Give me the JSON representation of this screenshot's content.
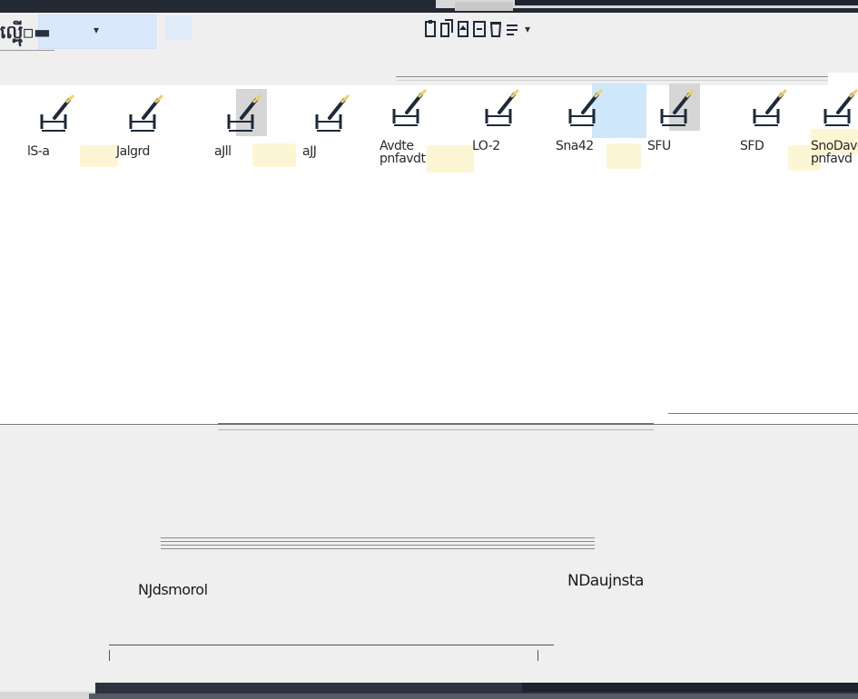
{
  "toolbar": {
    "view_label": "ល្អ៉ើ្ម▫▬",
    "view_caret": "▾",
    "center_caret": "▾"
  },
  "colors": {
    "titlebar": "#242a33",
    "taskbar": "#2c3240",
    "selection": "#cfe7fb",
    "panel": "#ffffff",
    "background": "#efefef",
    "accent_yellow": "#f1cf63",
    "icon_dark": "#1c2a3a"
  },
  "center_icons": [
    "clipboard-icon",
    "copy-icon",
    "paste-icon",
    "move-icon",
    "delete-icon",
    "properties-icon"
  ],
  "items": [
    {
      "label": "lS-a",
      "icon": "resize-brush-icon"
    },
    {
      "label": "Jalgrd",
      "icon": "resize-brush-icon"
    },
    {
      "label": "aJll",
      "icon": "resize-brush-icon"
    },
    {
      "label": "aJJ",
      "icon": "resize-brush-icon"
    },
    {
      "label": "Avdte\npnfavdt",
      "icon": "resize-brush-icon"
    },
    {
      "label": "LO-2",
      "icon": "resize-brush-icon"
    },
    {
      "label": "Sna42",
      "icon": "resize-brush-icon"
    },
    {
      "label": "SFU",
      "icon": "resize-brush-icon"
    },
    {
      "label": "SFD",
      "icon": "resize-brush-icon"
    },
    {
      "label": "SnoDave\npnfavd",
      "icon": "resize-brush-icon"
    }
  ],
  "status": {
    "left": "NJdsmorol",
    "right": "NDaujnsta"
  }
}
